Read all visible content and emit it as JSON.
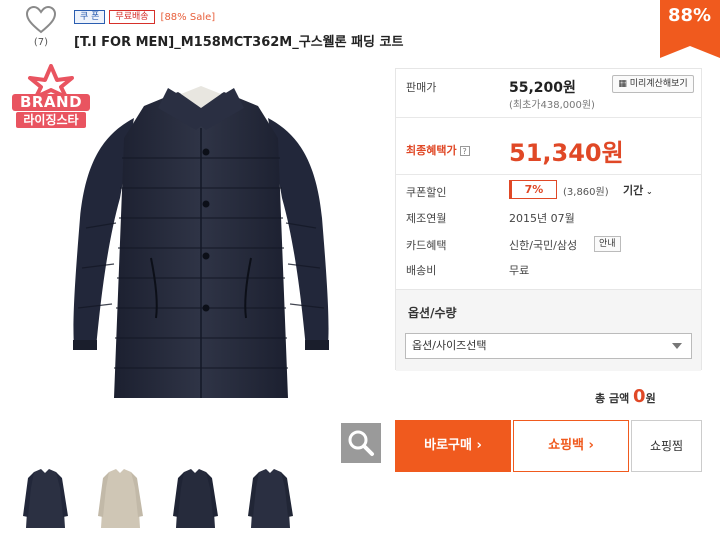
{
  "like": {
    "count": "(7)"
  },
  "badges": {
    "coupon": "쿠 폰",
    "free_ship": "무료배송",
    "sale": "[88% Sale]"
  },
  "product": {
    "title": "[T.I FOR MEN]_M158MCT362M_구스웰론 패딩 코트"
  },
  "discount_tag": "88%",
  "brand_logo": {
    "top": "BRAND",
    "bottom": "라이징스타"
  },
  "price": {
    "label": "판매가",
    "value": "55,200원",
    "sub": "(최초가438,000원)",
    "calc_button": "미리계산해보기"
  },
  "final_price": {
    "label": "최종혜택가",
    "help": "?",
    "value": "51,340원"
  },
  "details": {
    "coupon_label": "쿠폰할인",
    "coupon_pct": "7%",
    "coupon_amount": "(3,860원)",
    "coupon_period": "기간",
    "date_label": "제조연월",
    "date_value": "2015년 07월",
    "card_label": "카드혜택",
    "card_value": "신한/국민/삼성",
    "card_info_button": "안내",
    "ship_label": "배송비",
    "ship_value": "무료"
  },
  "options": {
    "title": "옵션/수량",
    "select_value": "옵션/사이즈선택"
  },
  "total": {
    "label": "총 금액",
    "value": "0",
    "unit": "원"
  },
  "buttons": {
    "buy": "바로구매",
    "bag": "쇼핑백",
    "wish": "쇼핑찜"
  },
  "colors": {
    "accent": "#f05a1e",
    "price_red": "#e04826",
    "coupon_blue": "#2a5db0"
  },
  "icons": [
    "heart-icon",
    "search-icon",
    "chevron-right-icon",
    "chevron-down-icon",
    "help-icon"
  ]
}
